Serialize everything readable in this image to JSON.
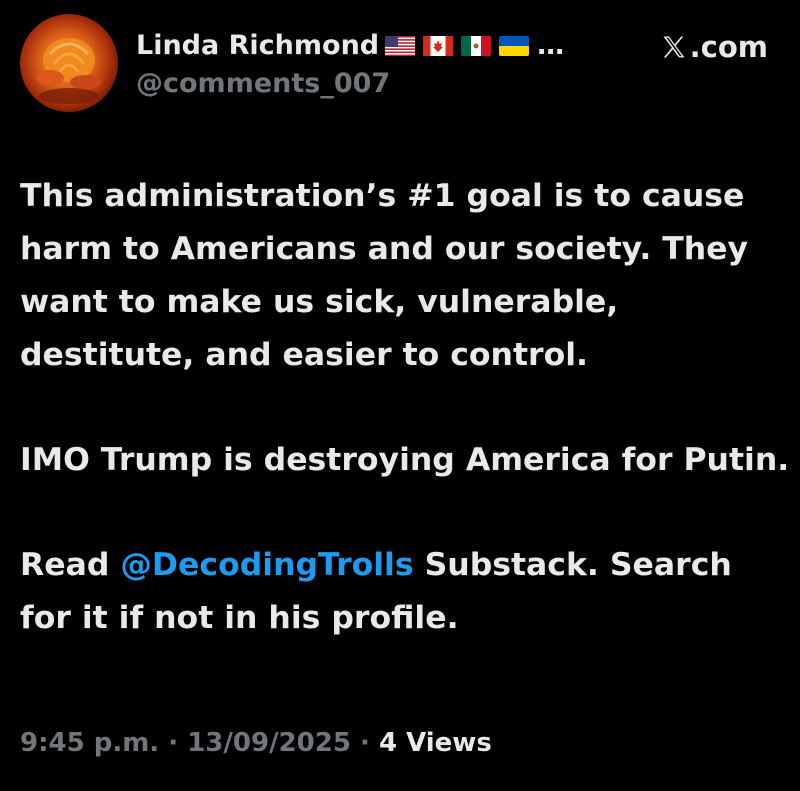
{
  "tweet": {
    "author": {
      "name": "Linda Richmond",
      "handle": "@comments_007",
      "flags": [
        "us-flag-icon",
        "canada-flag-icon",
        "mexico-flag-icon",
        "ukraine-flag-icon"
      ],
      "name_truncation": "…"
    },
    "source": {
      "label": ".com",
      "icon": "x-logo-icon"
    },
    "paragraphs": [
      "This administration’s #1 goal is to cause harm to Americans and our society. They want to make us sick, vulnerable, destitute, and easier to control.",
      "IMO Trump is destroying America for Putin."
    ],
    "last_paragraph": {
      "prefix": "Read",
      "mention": "@DecodingTrolls",
      "suffix": "Substack. Search for it if not in his profile."
    },
    "meta": {
      "time": "9:45 p.m.",
      "separator": "·",
      "date": "13/09/2025",
      "views_count": "4",
      "views_label": "Views"
    }
  },
  "colors": {
    "background": "#000000",
    "text": "#e7e9ea",
    "secondary": "#71767b",
    "mention": "#1d9bf0"
  }
}
